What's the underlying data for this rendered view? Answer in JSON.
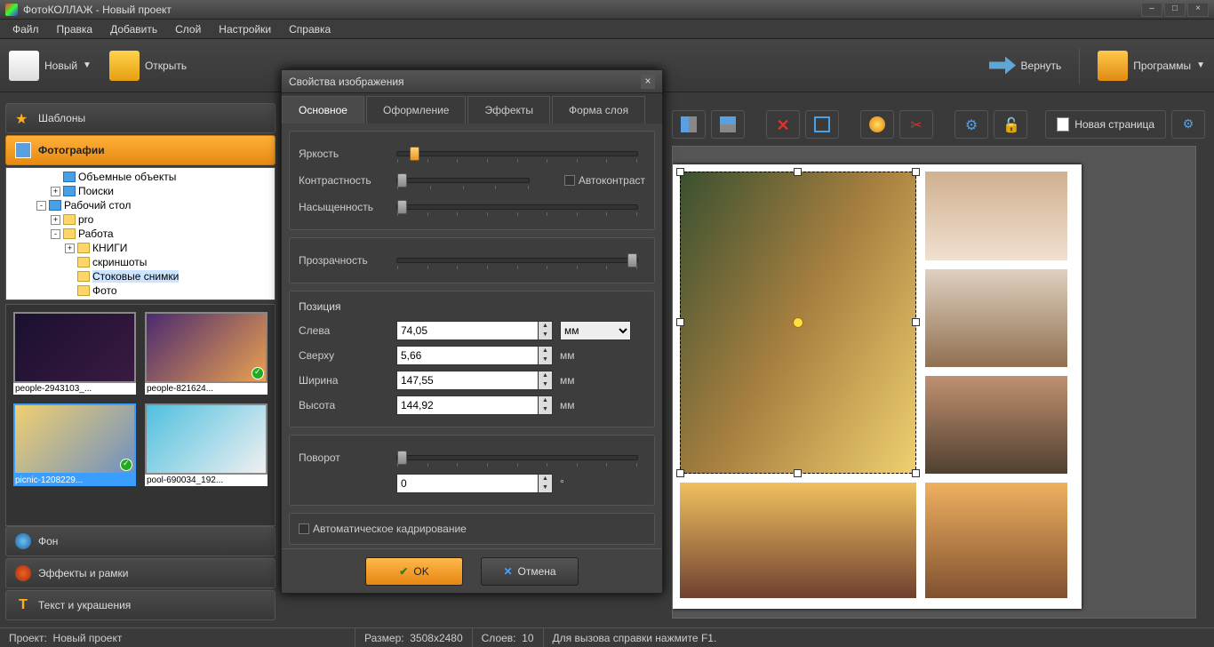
{
  "app_title": "ФотоКОЛЛАЖ - Новый проект",
  "menu": [
    "Файл",
    "Правка",
    "Добавить",
    "Слой",
    "Настройки",
    "Справка"
  ],
  "toolbar": {
    "new": "Новый",
    "open": "Открыть",
    "return": "Вернуть",
    "programs": "Программы",
    "new_page": "Новая страница"
  },
  "accordion": {
    "templates": "Шаблоны",
    "photos": "Фотографии",
    "background": "Фон",
    "effects": "Эффекты и рамки",
    "text": "Текст и украшения"
  },
  "tree": [
    {
      "indent": 3,
      "exp": "",
      "icon": "blue",
      "label": "Объемные объекты"
    },
    {
      "indent": 3,
      "exp": "+",
      "icon": "blue",
      "label": "Поиски"
    },
    {
      "indent": 2,
      "exp": "-",
      "icon": "blue",
      "label": "Рабочий стол"
    },
    {
      "indent": 3,
      "exp": "+",
      "icon": "y",
      "label": "pro"
    },
    {
      "indent": 3,
      "exp": "-",
      "icon": "y",
      "label": "Работа"
    },
    {
      "indent": 4,
      "exp": "+",
      "icon": "y",
      "label": "КНИГИ"
    },
    {
      "indent": 4,
      "exp": "",
      "icon": "y",
      "label": "скриншоты"
    },
    {
      "indent": 4,
      "exp": "",
      "icon": "y",
      "label": "Стоковые снимки",
      "sel": true
    },
    {
      "indent": 4,
      "exp": "",
      "icon": "y",
      "label": "Фото"
    }
  ],
  "thumbs": [
    {
      "name": "people-2943103_...",
      "chk": false,
      "colors": [
        "#1a1030",
        "#3a1a40"
      ]
    },
    {
      "name": "people-821624...",
      "chk": true,
      "colors": [
        "#4a2a70",
        "#eaa050"
      ]
    },
    {
      "name": "picnic-1208229...",
      "chk": true,
      "sel": true,
      "colors": [
        "#f0d070",
        "#7090c0"
      ]
    },
    {
      "name": "pool-690034_192...",
      "chk": false,
      "colors": [
        "#50c0e0",
        "#f0f0f0"
      ]
    }
  ],
  "dialog": {
    "title": "Свойства изображения",
    "tabs": [
      "Основное",
      "Оформление",
      "Эффекты",
      "Форма слоя"
    ],
    "active_tab": 0,
    "brightness": "Яркость",
    "contrast": "Контрастность",
    "saturation": "Насыщенность",
    "autocontrast": "Автоконтраст",
    "transparency": "Прозрачность",
    "position": "Позиция",
    "left": "Слева",
    "left_v": "74,05",
    "top": "Сверху",
    "top_v": "5,66",
    "width": "Ширина",
    "width_v": "147,55",
    "height": "Высота",
    "height_v": "144,92",
    "unit": "мм",
    "rotation": "Поворот",
    "rotation_v": "0",
    "rotation_unit": "°",
    "autocrop": "Автоматическое кадрирование",
    "ok": "OK",
    "cancel": "Отмена"
  },
  "status": {
    "project_label": "Проект:",
    "project": "Новый проект",
    "size_label": "Размер:",
    "size": "3508x2480",
    "layers_label": "Слоев:",
    "layers": "10",
    "help": "Для вызова справки нажмите F1."
  }
}
